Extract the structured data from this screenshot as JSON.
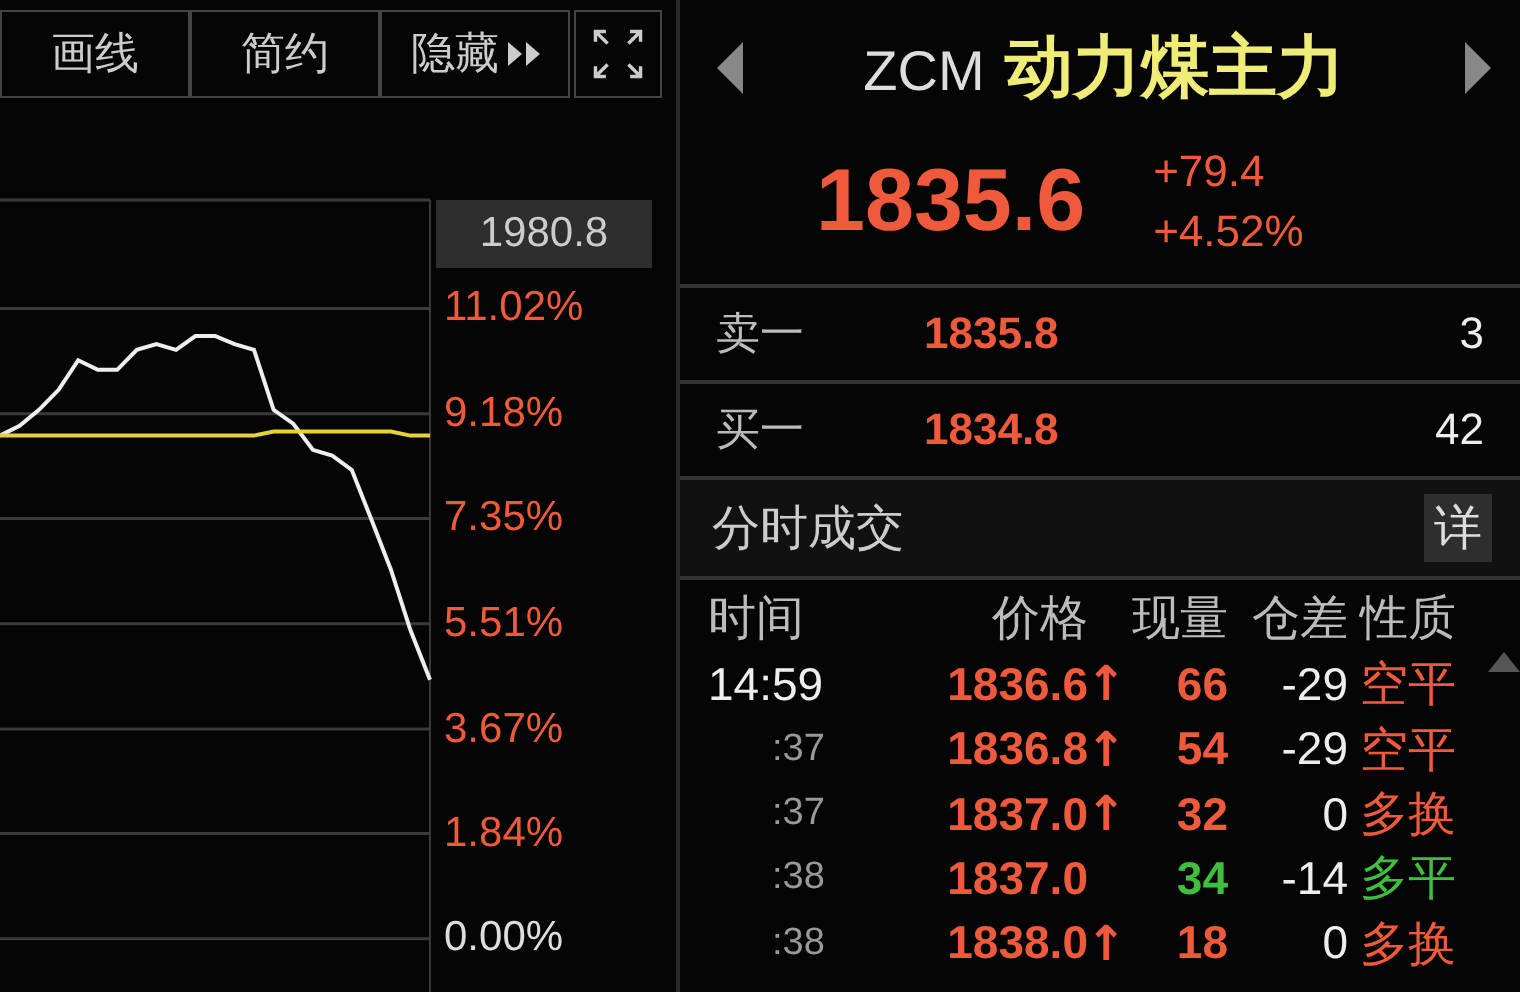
{
  "toolbar": {
    "buttons": [
      {
        "label": "画线",
        "kind": "text"
      },
      {
        "label": "简约",
        "kind": "text"
      },
      {
        "label": "隐藏",
        "kind": "expand"
      },
      {
        "kind": "fullscreen"
      }
    ]
  },
  "chart": {
    "tooltip": "1980.8",
    "chart_data": {
      "type": "line",
      "grid": true,
      "ylim": [
        -0.93,
        12.92
      ],
      "yticks": [
        {
          "value": 11.02,
          "label": "11.02%"
        },
        {
          "value": 9.18,
          "label": "9.18%"
        },
        {
          "value": 7.35,
          "label": "7.35%"
        },
        {
          "value": 5.51,
          "label": "5.51%"
        },
        {
          "value": 3.67,
          "label": "3.67%"
        },
        {
          "value": 1.84,
          "label": "1.84%"
        },
        {
          "value": 0,
          "label": "0.00%"
        }
      ],
      "series": [
        {
          "color": "#eeeeee",
          "values": [
            8.8,
            8.97,
            9.25,
            9.6,
            10.12,
            9.95,
            9.95,
            10.3,
            10.4,
            10.3,
            10.54,
            10.54,
            10.4,
            10.3,
            9.25,
            9.01,
            8.55,
            8.45,
            8.2,
            7.33,
            6.45,
            5.4,
            4.53
          ]
        },
        {
          "color": "#e6d23c",
          "values": [
            8.8,
            8.8,
            8.8,
            8.8,
            8.8,
            8.8,
            8.8,
            8.8,
            8.8,
            8.8,
            8.8,
            8.8,
            8.8,
            8.8,
            8.87,
            8.87,
            8.87,
            8.87,
            8.87,
            8.87,
            8.87,
            8.8,
            8.8
          ]
        }
      ]
    }
  },
  "quote": {
    "code": "ZCM",
    "name": "动力煤主力",
    "price": "1835.6",
    "change": "+79.4",
    "change_pct": "+4.52%"
  },
  "order_book": [
    {
      "label": "卖一",
      "price": "1835.8",
      "volume": "3"
    },
    {
      "label": "买一",
      "price": "1834.8",
      "volume": "42"
    }
  ],
  "trades": {
    "title": "分时成交",
    "detail_button": "详",
    "columns": [
      "时间",
      "价格",
      "现量",
      "仓差",
      "性质"
    ],
    "rows": [
      {
        "time": "14:59",
        "kind": "full",
        "price": "1836.6",
        "arrow": "↑",
        "volume": "66",
        "color": "#f05a3c",
        "oi_change": "-29",
        "nature": "空平"
      },
      {
        "time": ":37",
        "kind": "short",
        "price": "1836.8",
        "arrow": "↑",
        "volume": "54",
        "color": "#f05a3c",
        "oi_change": "-29",
        "nature": "空平"
      },
      {
        "time": ":37",
        "kind": "short",
        "price": "1837.0",
        "arrow": "↑",
        "volume": "32",
        "color": "#f05a3c",
        "oi_change": "0",
        "nature": "多换"
      },
      {
        "time": ":38",
        "kind": "short",
        "price": "1837.0",
        "volume": "34",
        "color": "#3ec03e",
        "oi_change": "-14",
        "nature": "多平"
      },
      {
        "time": ":38",
        "kind": "short",
        "price": "1838.0",
        "arrow": "↑",
        "volume": "18",
        "color": "#f05a3c",
        "oi_change": "0",
        "nature": "多换"
      }
    ]
  }
}
